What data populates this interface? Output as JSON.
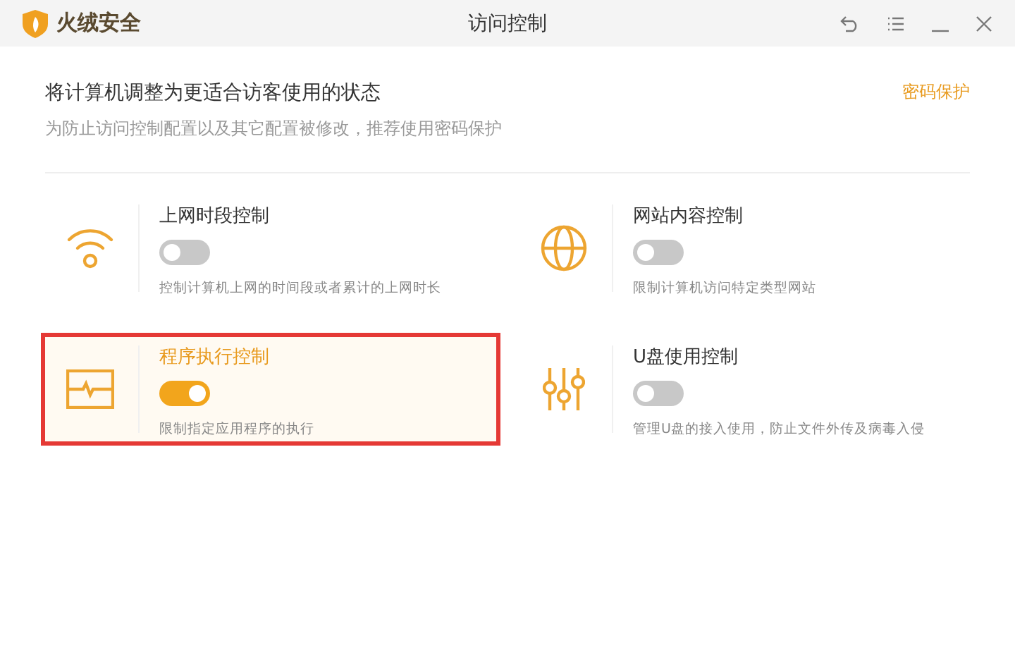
{
  "window": {
    "brand": "火绒安全",
    "title": "访问控制"
  },
  "header": {
    "heading": "将计算机调整为更适合访客使用的状态",
    "description": "为防止访问控制配置以及其它配置被修改，推荐使用密码保护",
    "link": "密码保护"
  },
  "controls": [
    {
      "kind": "wifi",
      "title": "上网时段控制",
      "description": "控制计算机上网的时间段或者累计的上网时长",
      "on": false,
      "selected": false
    },
    {
      "kind": "globe",
      "title": "网站内容控制",
      "description": "限制计算机访问特定类型网站",
      "on": false,
      "selected": false
    },
    {
      "kind": "monitor",
      "title": "程序执行控制",
      "description": "限制指定应用程序的执行",
      "on": true,
      "selected": true
    },
    {
      "kind": "sliders",
      "title": "U盘使用控制",
      "description": "管理U盘的接入使用，防止文件外传及病毒入侵",
      "on": false,
      "selected": false
    }
  ]
}
